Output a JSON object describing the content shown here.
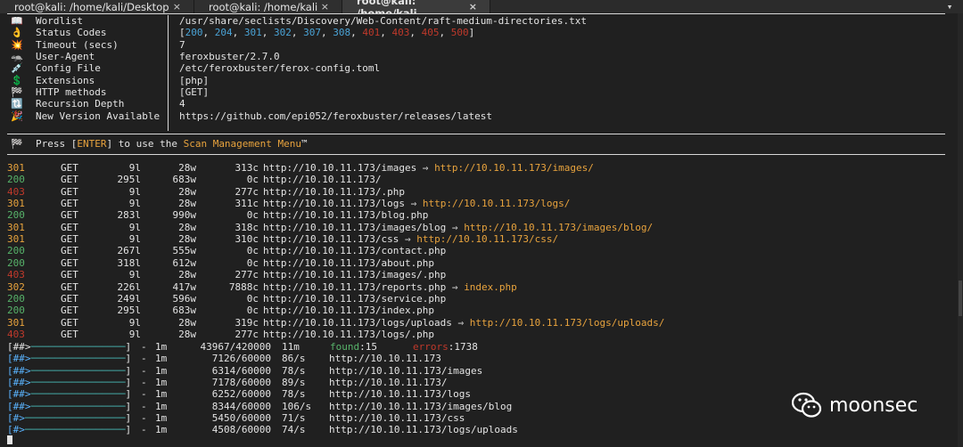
{
  "tabs": [
    {
      "title": "root@kali: /home/kali/Desktop",
      "close": "×"
    },
    {
      "title": "root@kali: /home/kali",
      "close": "×"
    },
    {
      "title": "root@kali: /home/kali",
      "close": "×"
    }
  ],
  "tabbar_more": "▾",
  "config": [
    {
      "icon": "📖",
      "label": "Wordlist",
      "value": "/usr/share/seclists/Discovery/Web-Content/raft-medium-directories.txt"
    },
    {
      "icon": "👌",
      "label": "Status Codes",
      "value": "[200, 204, 301, 302, 307, 308, 401, 403, 405, 500]"
    },
    {
      "icon": "💥",
      "label": "Timeout (secs)",
      "value": "7"
    },
    {
      "icon": "🦡",
      "label": "User-Agent",
      "value": "feroxbuster/2.7.0"
    },
    {
      "icon": "💉",
      "label": "Config File",
      "value": "/etc/feroxbuster/ferox-config.toml"
    },
    {
      "icon": "💲",
      "label": "Extensions",
      "value": "[php]"
    },
    {
      "icon": "🏁",
      "label": "HTTP methods",
      "value": "[GET]"
    },
    {
      "icon": "🔃",
      "label": "Recursion Depth",
      "value": "4"
    },
    {
      "icon": "🎉",
      "label": "New Version Available",
      "value": "https://github.com/epi052/feroxbuster/releases/latest"
    }
  ],
  "status_codes_parts": [
    {
      "t": "[",
      "c": ""
    },
    {
      "t": "200",
      "c": "blue"
    },
    {
      "t": ", ",
      "c": ""
    },
    {
      "t": "204",
      "c": "blue"
    },
    {
      "t": ", ",
      "c": ""
    },
    {
      "t": "301",
      "c": "blue"
    },
    {
      "t": ", ",
      "c": ""
    },
    {
      "t": "302",
      "c": "blue"
    },
    {
      "t": ", ",
      "c": ""
    },
    {
      "t": "307",
      "c": "blue"
    },
    {
      "t": ", ",
      "c": ""
    },
    {
      "t": "308",
      "c": "blue"
    },
    {
      "t": ", ",
      "c": ""
    },
    {
      "t": "401",
      "c": "red"
    },
    {
      "t": ", ",
      "c": ""
    },
    {
      "t": "403",
      "c": "red"
    },
    {
      "t": ", ",
      "c": ""
    },
    {
      "t": "405",
      "c": "red"
    },
    {
      "t": ", ",
      "c": ""
    },
    {
      "t": "500",
      "c": "red"
    },
    {
      "t": "]",
      "c": ""
    }
  ],
  "press_line": {
    "icon": "🏁",
    "pre": "Press [",
    "key": "ENTER",
    "mid": "] to use the ",
    "menu": "Scan Management Menu",
    "post": "™"
  },
  "results": [
    {
      "code": "301",
      "method": "GET",
      "lines": "9l",
      "words": "28w",
      "chars": "313c",
      "url": "http://10.10.11.173/images",
      "redirect": "http://10.10.11.173/images/"
    },
    {
      "code": "200",
      "method": "GET",
      "lines": "295l",
      "words": "683w",
      "chars": "0c",
      "url": "http://10.10.11.173/",
      "redirect": ""
    },
    {
      "code": "403",
      "method": "GET",
      "lines": "9l",
      "words": "28w",
      "chars": "277c",
      "url": "http://10.10.11.173/.php",
      "redirect": ""
    },
    {
      "code": "301",
      "method": "GET",
      "lines": "9l",
      "words": "28w",
      "chars": "311c",
      "url": "http://10.10.11.173/logs",
      "redirect": "http://10.10.11.173/logs/"
    },
    {
      "code": "200",
      "method": "GET",
      "lines": "283l",
      "words": "990w",
      "chars": "0c",
      "url": "http://10.10.11.173/blog.php",
      "redirect": ""
    },
    {
      "code": "301",
      "method": "GET",
      "lines": "9l",
      "words": "28w",
      "chars": "318c",
      "url": "http://10.10.11.173/images/blog",
      "redirect": "http://10.10.11.173/images/blog/"
    },
    {
      "code": "301",
      "method": "GET",
      "lines": "9l",
      "words": "28w",
      "chars": "310c",
      "url": "http://10.10.11.173/css",
      "redirect": "http://10.10.11.173/css/"
    },
    {
      "code": "200",
      "method": "GET",
      "lines": "267l",
      "words": "555w",
      "chars": "0c",
      "url": "http://10.10.11.173/contact.php",
      "redirect": ""
    },
    {
      "code": "200",
      "method": "GET",
      "lines": "318l",
      "words": "612w",
      "chars": "0c",
      "url": "http://10.10.11.173/about.php",
      "redirect": ""
    },
    {
      "code": "403",
      "method": "GET",
      "lines": "9l",
      "words": "28w",
      "chars": "277c",
      "url": "http://10.10.11.173/images/.php",
      "redirect": ""
    },
    {
      "code": "302",
      "method": "GET",
      "lines": "226l",
      "words": "417w",
      "chars": "7888c",
      "url": "http://10.10.11.173/reports.php",
      "redirect": "index.php"
    },
    {
      "code": "200",
      "method": "GET",
      "lines": "249l",
      "words": "596w",
      "chars": "0c",
      "url": "http://10.10.11.173/service.php",
      "redirect": ""
    },
    {
      "code": "200",
      "method": "GET",
      "lines": "295l",
      "words": "683w",
      "chars": "0c",
      "url": "http://10.10.11.173/index.php",
      "redirect": ""
    },
    {
      "code": "301",
      "method": "GET",
      "lines": "9l",
      "words": "28w",
      "chars": "319c",
      "url": "http://10.10.11.173/logs/uploads",
      "redirect": "http://10.10.11.173/logs/uploads/"
    },
    {
      "code": "403",
      "method": "GET",
      "lines": "9l",
      "words": "28w",
      "chars": "277c",
      "url": "http://10.10.11.173/logs/.php",
      "redirect": ""
    }
  ],
  "progress": [
    {
      "bar": "[##>",
      "fill": "────────────────",
      "close": "]",
      "time": "1m",
      "count": "43967/420000",
      "rate": "11m",
      "url": "",
      "found_label": "found",
      "found": "15",
      "errors_label": "errors",
      "errors": "1738"
    },
    {
      "bar": "[##>",
      "fill": "────────────────",
      "close": "]",
      "time": "1m",
      "count": "7126/60000",
      "rate": "86/s",
      "url": "http://10.10.11.173"
    },
    {
      "bar": "[##>",
      "fill": "────────────────",
      "close": "]",
      "time": "1m",
      "count": "6314/60000",
      "rate": "78/s",
      "url": "http://10.10.11.173/images"
    },
    {
      "bar": "[##>",
      "fill": "────────────────",
      "close": "]",
      "time": "1m",
      "count": "7178/60000",
      "rate": "89/s",
      "url": "http://10.10.11.173/"
    },
    {
      "bar": "[##>",
      "fill": "────────────────",
      "close": "]",
      "time": "1m",
      "count": "6252/60000",
      "rate": "78/s",
      "url": "http://10.10.11.173/logs"
    },
    {
      "bar": "[##>",
      "fill": "────────────────",
      "close": "]",
      "time": "1m",
      "count": "8344/60000",
      "rate": "106/s",
      "url": "http://10.10.11.173/images/blog"
    },
    {
      "bar": "[#>",
      "fill": "─────────────────",
      "close": "]",
      "time": "1m",
      "count": "5450/60000",
      "rate": "71/s",
      "url": "http://10.10.11.173/css"
    },
    {
      "bar": "[#>",
      "fill": "─────────────────",
      "close": "]",
      "time": "1m",
      "count": "4508/60000",
      "rate": "74/s",
      "url": "http://10.10.11.173/logs/uploads"
    }
  ],
  "progress_sep": "-",
  "watermark": {
    "text": "moonsec"
  },
  "colors": {
    "bg": "#202020",
    "blue": "#4aa3d6",
    "red": "#c0392b",
    "orange": "#e8a33d",
    "green": "#57b36a",
    "teal": "#46b3b0",
    "lightblue": "#5ab4ff"
  }
}
